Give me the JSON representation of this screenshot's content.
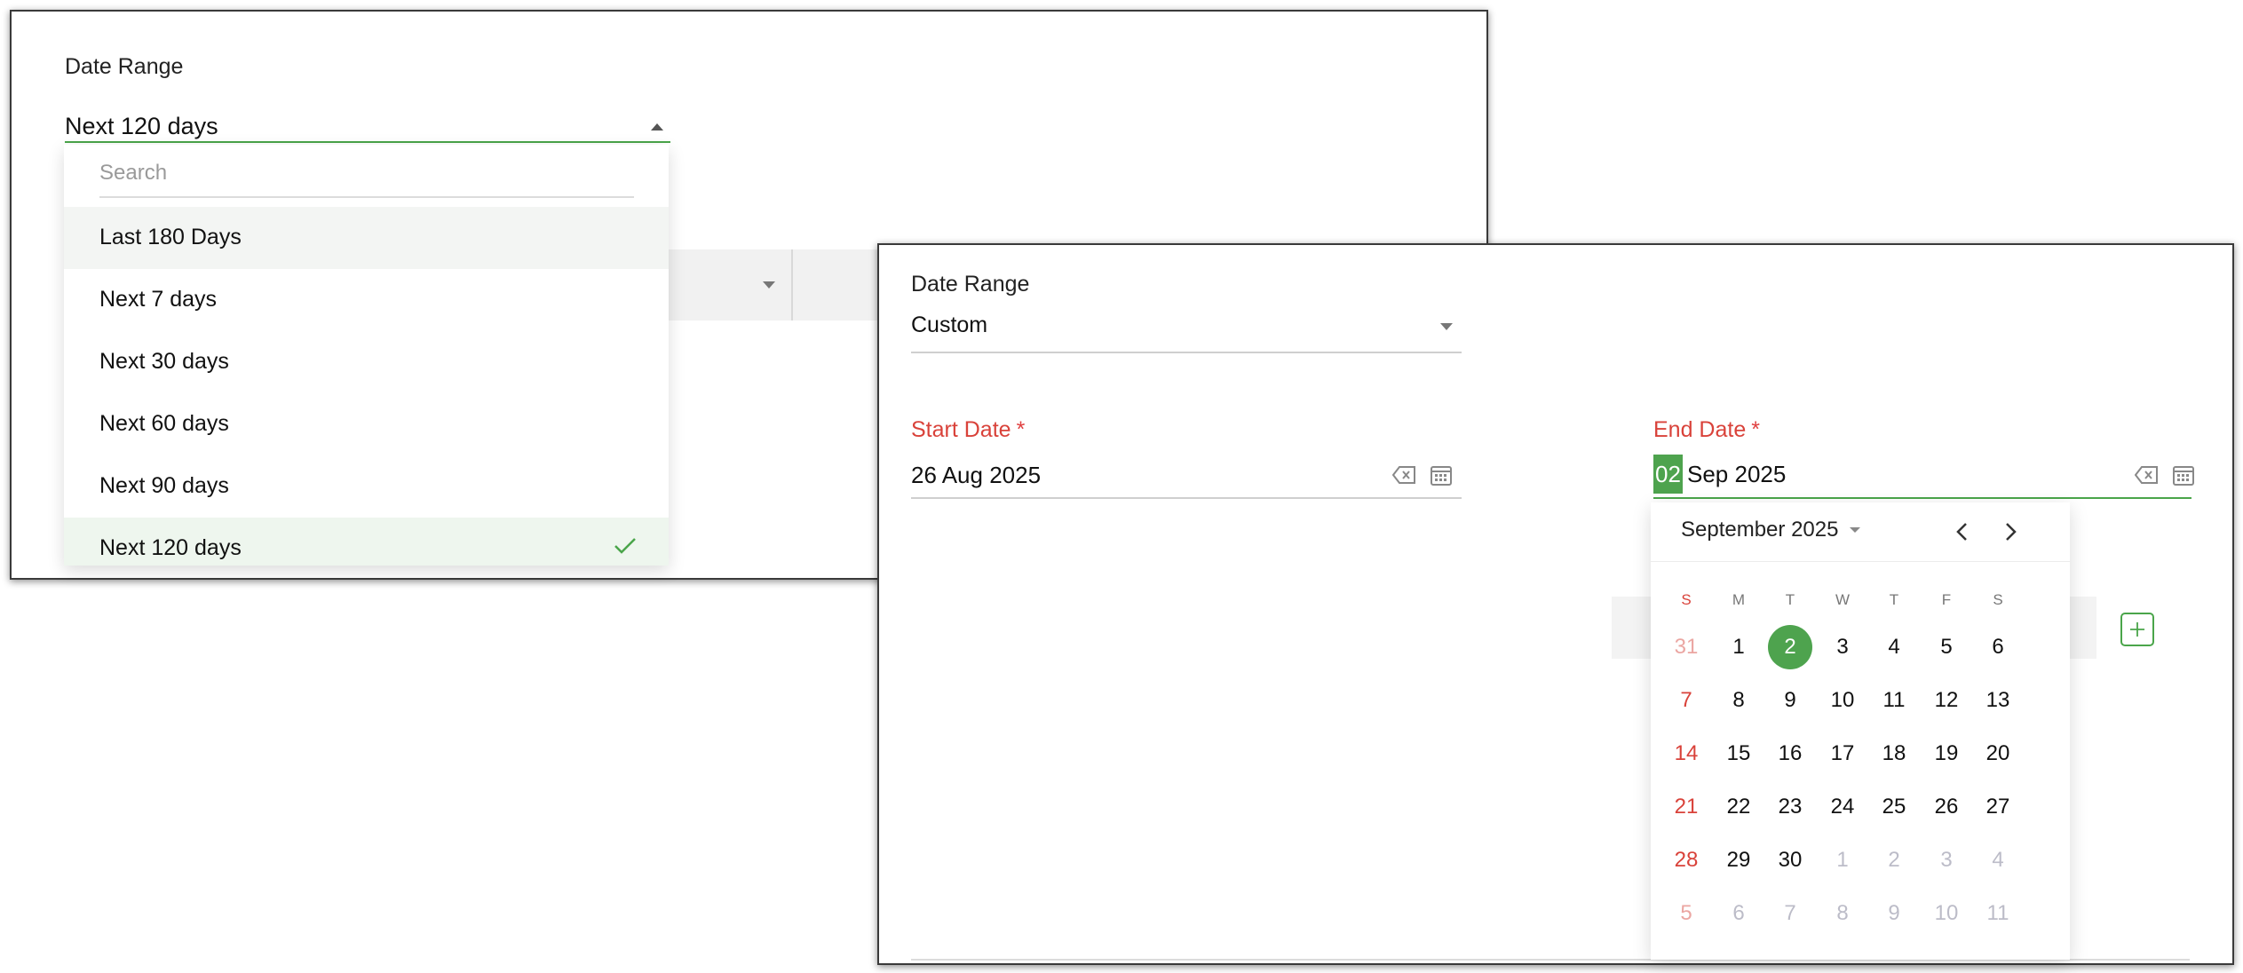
{
  "left_panel": {
    "label": "Date Range",
    "selected_value": "Next 120 days",
    "dropdown": {
      "search_placeholder": "Search",
      "items": [
        {
          "label": "Last 180 Days",
          "state": "hover"
        },
        {
          "label": "Next 7 days",
          "state": ""
        },
        {
          "label": "Next 30 days",
          "state": ""
        },
        {
          "label": "Next 60 days",
          "state": ""
        },
        {
          "label": "Next 90 days",
          "state": ""
        },
        {
          "label": "Next 120 days",
          "state": "selected"
        }
      ]
    }
  },
  "right_panel": {
    "date_range_label": "Date Range",
    "date_range_value": "Custom",
    "start_date": {
      "label": "Start Date",
      "required_mark": "*",
      "value": "26 Aug 2025"
    },
    "end_date": {
      "label": "End Date",
      "required_mark": "*",
      "day_highlight": "02",
      "value_rest": "Sep 2025"
    },
    "calendar": {
      "month_label": "September 2025",
      "weekdays": [
        "S",
        "M",
        "T",
        "W",
        "T",
        "F",
        "S"
      ],
      "selected_day": "2",
      "weeks": [
        [
          {
            "d": "31",
            "o": true
          },
          {
            "d": "1"
          },
          {
            "d": "2",
            "sel": true
          },
          {
            "d": "3"
          },
          {
            "d": "4"
          },
          {
            "d": "5"
          },
          {
            "d": "6"
          }
        ],
        [
          {
            "d": "7"
          },
          {
            "d": "8"
          },
          {
            "d": "9"
          },
          {
            "d": "10"
          },
          {
            "d": "11"
          },
          {
            "d": "12"
          },
          {
            "d": "13"
          }
        ],
        [
          {
            "d": "14"
          },
          {
            "d": "15"
          },
          {
            "d": "16"
          },
          {
            "d": "17"
          },
          {
            "d": "18"
          },
          {
            "d": "19"
          },
          {
            "d": "20"
          }
        ],
        [
          {
            "d": "21"
          },
          {
            "d": "22"
          },
          {
            "d": "23"
          },
          {
            "d": "24"
          },
          {
            "d": "25"
          },
          {
            "d": "26"
          },
          {
            "d": "27"
          }
        ],
        [
          {
            "d": "28"
          },
          {
            "d": "29"
          },
          {
            "d": "30"
          },
          {
            "d": "1",
            "o": true
          },
          {
            "d": "2",
            "o": true
          },
          {
            "d": "3",
            "o": true
          },
          {
            "d": "4",
            "o": true
          }
        ],
        [
          {
            "d": "5",
            "o": true
          },
          {
            "d": "6",
            "o": true
          },
          {
            "d": "7",
            "o": true
          },
          {
            "d": "8",
            "o": true
          },
          {
            "d": "9",
            "o": true
          },
          {
            "d": "10",
            "o": true
          },
          {
            "d": "11",
            "o": true
          }
        ]
      ]
    }
  },
  "colors": {
    "accent_green": "#4ea34e",
    "required_red": "#d9423a"
  },
  "icons": [
    "caret-up-icon",
    "caret-down-icon",
    "check-icon",
    "clear-icon",
    "calendar-icon",
    "chevron-left-icon",
    "chevron-right-icon",
    "plus-icon"
  ]
}
